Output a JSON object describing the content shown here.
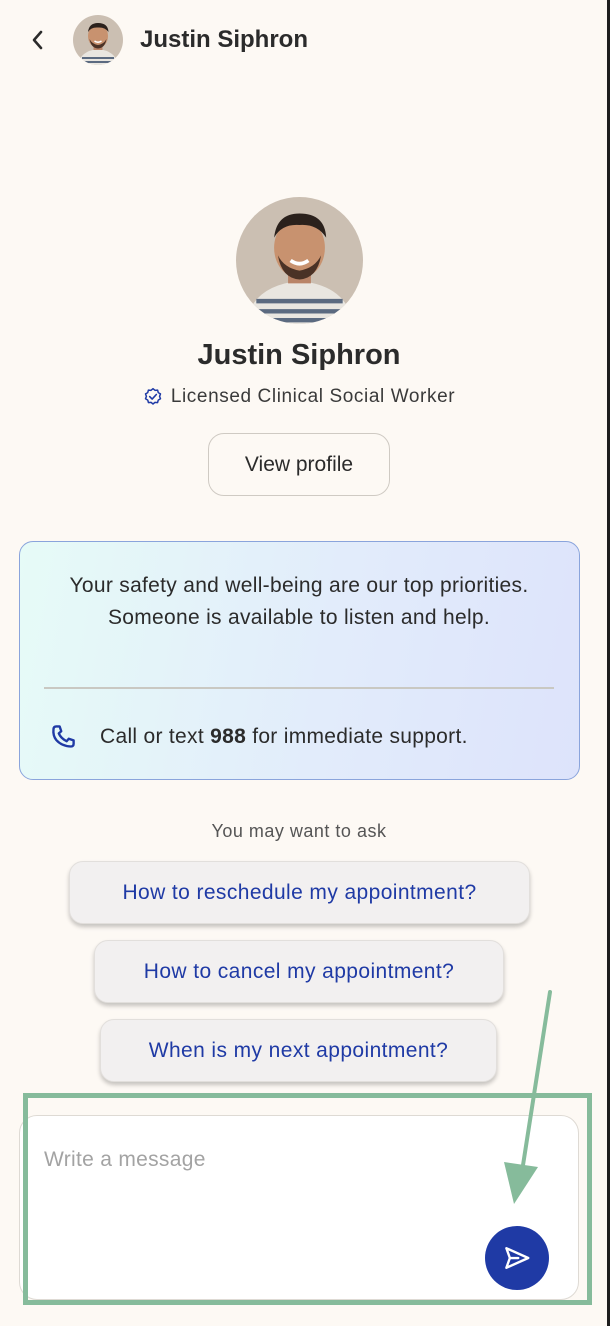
{
  "header": {
    "back_icon": "chevron-left-icon",
    "name": "Justin Siphron"
  },
  "profile": {
    "name": "Justin Siphron",
    "credential": "Licensed Clinical Social Worker",
    "verified_icon": "verified-badge-icon",
    "view_profile_label": "View profile"
  },
  "safety": {
    "message": "Your safety and well-being are our top priorities. Someone is available to listen and help.",
    "call_prefix": "Call or text ",
    "call_number": "988",
    "call_suffix": " for immediate support.",
    "phone_icon": "phone-icon"
  },
  "suggestions": {
    "label": "You may want to ask",
    "items": [
      "How to reschedule my appointment?",
      "How to cancel my appointment?",
      "When is my next appointment?"
    ]
  },
  "composer": {
    "placeholder": "Write a message",
    "value": "",
    "send_icon": "send-icon"
  },
  "colors": {
    "accent": "#1f3aa5",
    "background": "#fdf9f4",
    "annotation": "#86bb9b"
  }
}
